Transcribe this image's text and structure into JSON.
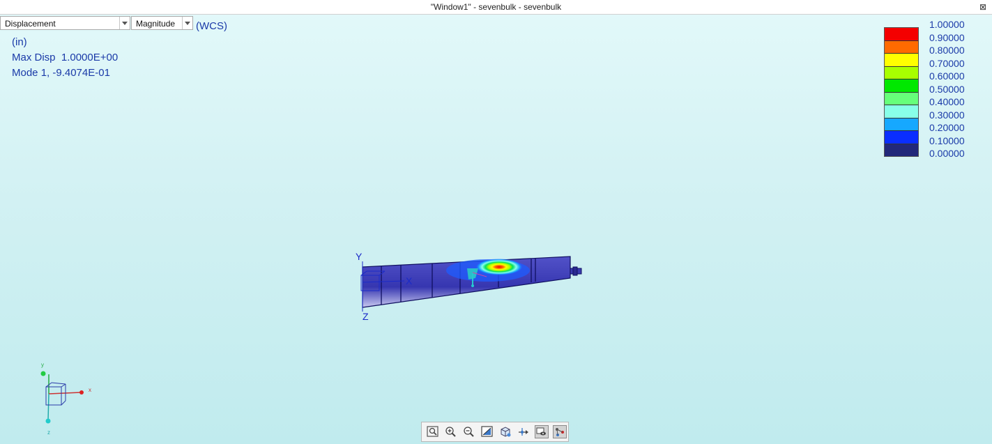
{
  "window": {
    "title": "\"Window1\" - sevenbulk - sevenbulk",
    "close_glyph": "⊠"
  },
  "result_selector": {
    "value": "Displacement"
  },
  "component_selector": {
    "value": "Magnitude"
  },
  "coord_system": "(WCS)",
  "info": {
    "units": "(in)",
    "max_disp": "Max Disp  1.0000E+00",
    "mode": "Mode 1, -9.4074E-01"
  },
  "legend": {
    "labels": [
      "1.00000",
      "0.90000",
      "0.80000",
      "0.70000",
      "0.60000",
      "0.50000",
      "0.40000",
      "0.30000",
      "0.20000",
      "0.10000",
      "0.00000"
    ],
    "colors": [
      "#f40000",
      "#ff6a00",
      "#ffff00",
      "#a8ff00",
      "#00e800",
      "#66ff7a",
      "#88ffe8",
      "#16a8ff",
      "#0a2eff",
      "#22287a"
    ]
  },
  "model_axes": {
    "x": "X",
    "y": "Y",
    "z": "Z"
  },
  "triad": {
    "x": "x",
    "y": "y",
    "z": "z"
  },
  "toolbar": {
    "buttons": [
      {
        "icon": "refit-icon"
      },
      {
        "icon": "zoom-in-icon"
      },
      {
        "icon": "zoom-out-icon"
      },
      {
        "icon": "repaint-icon"
      },
      {
        "icon": "saved-views-icon"
      },
      {
        "icon": "spin-center-icon"
      },
      {
        "icon": "display-style-icon"
      },
      {
        "icon": "orient-icon"
      }
    ]
  },
  "colors": {
    "text_blue": "#1a3aa8",
    "model_body": "#3d3db5",
    "model_edge": "#101060",
    "background_top": "#e3f9fa",
    "background_bottom": "#c0ebee"
  }
}
